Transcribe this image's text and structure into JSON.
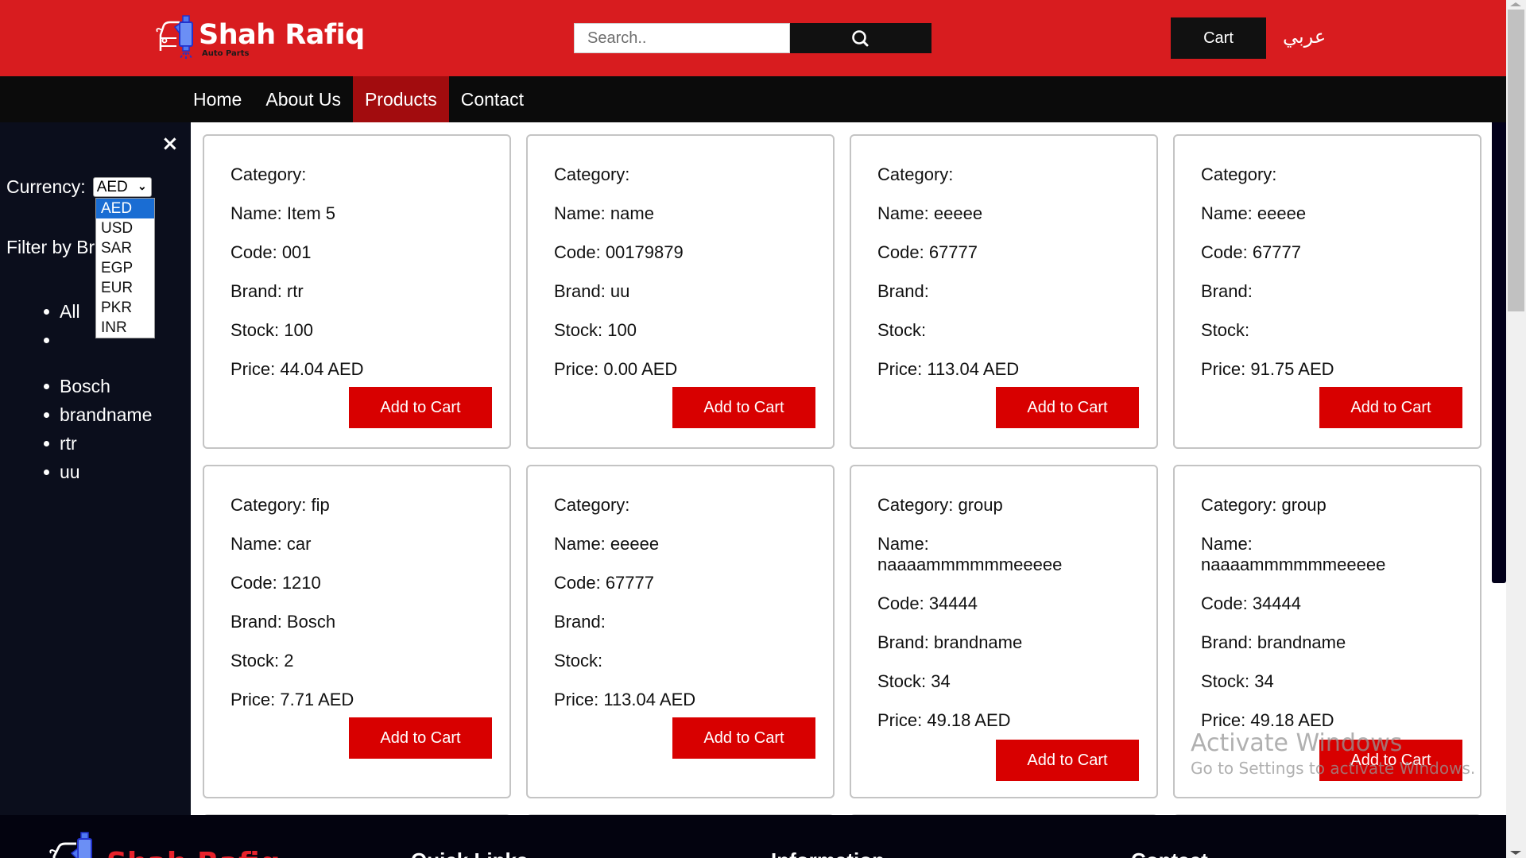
{
  "header": {
    "brand_title": "Shah Rafiq",
    "brand_subtitle": "Auto Parts",
    "search_placeholder": "Search..",
    "search_icon": "search-icon",
    "cart_label": "Cart",
    "language_link": "عربي"
  },
  "nav": {
    "items": [
      {
        "label": "Home",
        "active": false
      },
      {
        "label": "About Us",
        "active": false
      },
      {
        "label": "Products",
        "active": true
      },
      {
        "label": "Contact",
        "active": false
      }
    ]
  },
  "sidebar": {
    "close_icon": "×",
    "currency_label": "Currency:",
    "currency_selected": "AED",
    "currency_options": [
      "AED",
      "USD",
      "SAR",
      "EGP",
      "EUR",
      "PKR",
      "INR"
    ],
    "filter_label": "Filter by Brand",
    "brands": [
      "All",
      "",
      "Bosch",
      "brandname",
      "rtr",
      "uu"
    ]
  },
  "products": [
    {
      "category": "Category: ",
      "name": "Name: Item 5",
      "code": "Code: 001",
      "brand": "Brand: rtr",
      "stock": "Stock: 100",
      "price": "Price: 44.04 AED",
      "button": "Add to Cart"
    },
    {
      "category": "Category: ",
      "name": "Name: name",
      "code": "Code: 00179879",
      "brand": "Brand: uu",
      "stock": "Stock: 100",
      "price": "Price: 0.00 AED",
      "button": "Add to Cart"
    },
    {
      "category": "Category: ",
      "name": "Name: eeeee",
      "code": "Code: 67777",
      "brand": "Brand: ",
      "stock": "Stock: ",
      "price": "Price: 113.04 AED",
      "button": "Add to Cart"
    },
    {
      "category": "Category: ",
      "name": "Name: eeeee",
      "code": "Code: 67777",
      "brand": "Brand: ",
      "stock": "Stock: ",
      "price": "Price: 91.75 AED",
      "button": "Add to Cart"
    },
    {
      "category": "Category: fip",
      "name": "Name: car",
      "code": "Code: 1210",
      "brand": "Brand: Bosch",
      "stock": "Stock: 2",
      "price": "Price: 7.71 AED",
      "button": "Add to Cart"
    },
    {
      "category": "Category: ",
      "name": "Name: eeeee",
      "code": "Code: 67777",
      "brand": "Brand: ",
      "stock": "Stock: ",
      "price": "Price: 113.04 AED",
      "button": "Add to Cart"
    },
    {
      "category": "Category: group",
      "name": "Name: naaaammmmmmeeeee",
      "code": "Code: 34444",
      "brand": "Brand: brandname",
      "stock": "Stock: 34",
      "price": "Price: 49.18 AED",
      "button": "Add to Cart"
    },
    {
      "category": "Category: group",
      "name": "Name: naaaammmmmmeeeee",
      "code": "Code: 34444",
      "brand": "Brand: brandname",
      "stock": "Stock: 34",
      "price": "Price: 49.18 AED",
      "button": "Add to Cart"
    }
  ],
  "footer": {
    "brand_title": "Shah Rafiq",
    "headings": [
      "Quick Links",
      "Information",
      "Contact"
    ]
  },
  "watermark": {
    "title": "Activate Windows",
    "subtitle": "Go to Settings to activate Windows."
  },
  "colors": {
    "header_bg": "#d81c1f",
    "nav_bg": "#0b0b0b",
    "nav_active": "#a20c0e",
    "sidebar_bg": "#0b0e1c",
    "button_red": "#d80000",
    "footer_bg": "#03030f"
  }
}
